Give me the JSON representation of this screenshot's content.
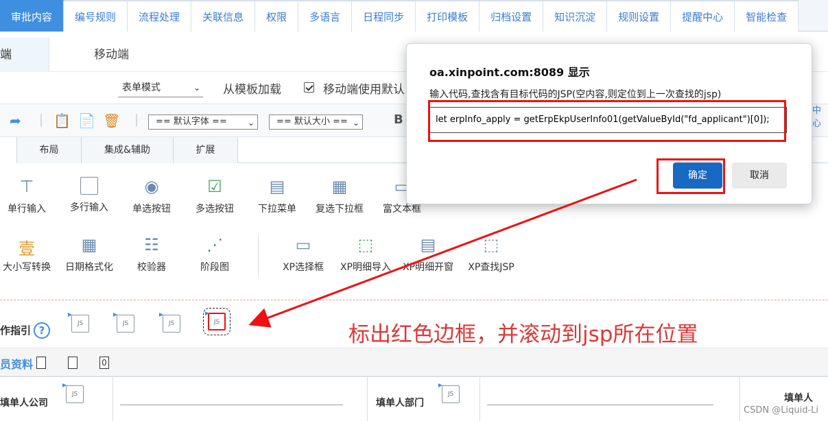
{
  "top_tabs": [
    "审批内容",
    "编号规则",
    "流程处理",
    "关联信息",
    "权限",
    "多语言",
    "日程同步",
    "打印模板",
    "归档设置",
    "知识沉淀",
    "规则设置",
    "提醒中心",
    "智能检查"
  ],
  "device_tabs": {
    "pc": "端",
    "mobile": "移动端"
  },
  "form_bar": {
    "mode_select": "表单模式",
    "load_from_template": "从模板加载",
    "mobile_default_checkbox": "移动端使用默认"
  },
  "toolbar": {
    "font_select": "== 默认字体 ==",
    "size_select": "== 默认大小 ==",
    "bold": "B"
  },
  "section_tabs": [
    "布局",
    "集成&辅助",
    "扩展"
  ],
  "palette_row1": [
    "单行输入",
    "多行输入",
    "单选按钮",
    "多选按钮",
    "下拉菜单",
    "复选下拉框",
    "富文本框"
  ],
  "palette_row2": [
    "大小写转换",
    "日期格式化",
    "校验器",
    "阶段图",
    "XP选择框",
    "XP明细导入",
    "XP明细开窗",
    "XP查找JSP"
  ],
  "palette_icons": [
    "single-line-input-icon",
    "multi-line-input-icon",
    "radio-icon",
    "checkbox-icon",
    "dropdown-icon",
    "multi-dropdown-icon",
    "rich-text-icon",
    "case-convert-icon",
    "date-format-icon",
    "validator-icon",
    "stage-chart-icon",
    "xp-select-icon",
    "xp-import-icon",
    "xp-window-icon",
    "xp-find-jsp-icon"
  ],
  "guide": {
    "label": "作指引",
    "help": "?"
  },
  "js_label": "JS",
  "annotation": "标出红色边框，并滚动到jsp所在位置",
  "info": {
    "label": "员资料",
    "box3": "0"
  },
  "table": {
    "company": "填单人公司",
    "department": "填单人部门",
    "applicant": "填单人"
  },
  "modal": {
    "title": "oa.xinpoint.com:8089 显示",
    "description": "输入代码,查找含有目标代码的JSP(空内容,则定位到上一次查找的jsp)",
    "input_value": "let erpInfo_apply = getErpEkpUserInfo01(getValueById(\"fd_applicant\")[0]);",
    "ok": "确定",
    "cancel": "取消"
  },
  "background_partial": "中心",
  "watermark": "CSDN @Liquid-Li",
  "colors": {
    "accent": "#3f8fe0",
    "annotation_red": "#e03636",
    "ok_button": "#1769c2"
  }
}
